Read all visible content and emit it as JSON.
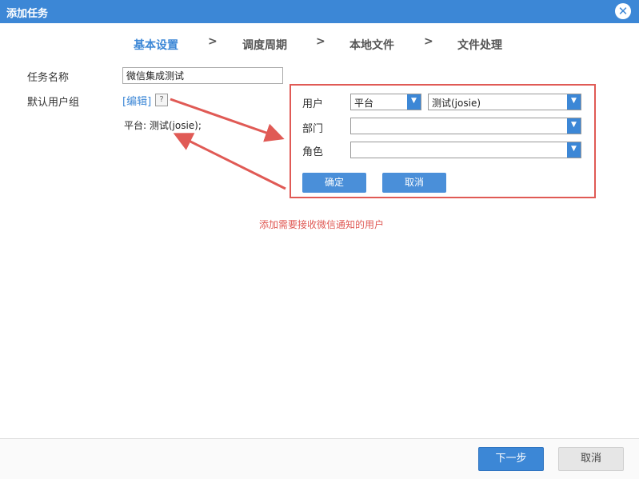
{
  "dialog": {
    "title": "添加任务",
    "close_icon": "close-circle-icon"
  },
  "steps": [
    {
      "label": "基本设置",
      "active": true
    },
    {
      "label": "调度周期",
      "active": false
    },
    {
      "label": "本地文件",
      "active": false
    },
    {
      "label": "文件处理",
      "active": false
    }
  ],
  "step_separator": ">",
  "form": {
    "task_name_label": "任务名称",
    "task_name_value": "微信集成测试",
    "default_group_label": "默认用户组",
    "edit_link": "[编辑]",
    "help_icon_text": "?",
    "selected_summary": "平台: 测试(josie);"
  },
  "popup": {
    "user_label": "用户",
    "user_type_value": "平台",
    "user_value": "测试(josie)",
    "dept_label": "部门",
    "dept_value": "",
    "role_label": "角色",
    "role_value": "",
    "confirm_label": "确定",
    "cancel_label": "取消",
    "dropdown_glyph": "▼"
  },
  "annotation": {
    "note": "添加需要接收微信通知的用户",
    "color": "#e05a55"
  },
  "footer": {
    "next_label": "下一步",
    "cancel_label": "取消"
  },
  "colors": {
    "accent": "#3c87d6",
    "highlight": "#e05a55"
  }
}
